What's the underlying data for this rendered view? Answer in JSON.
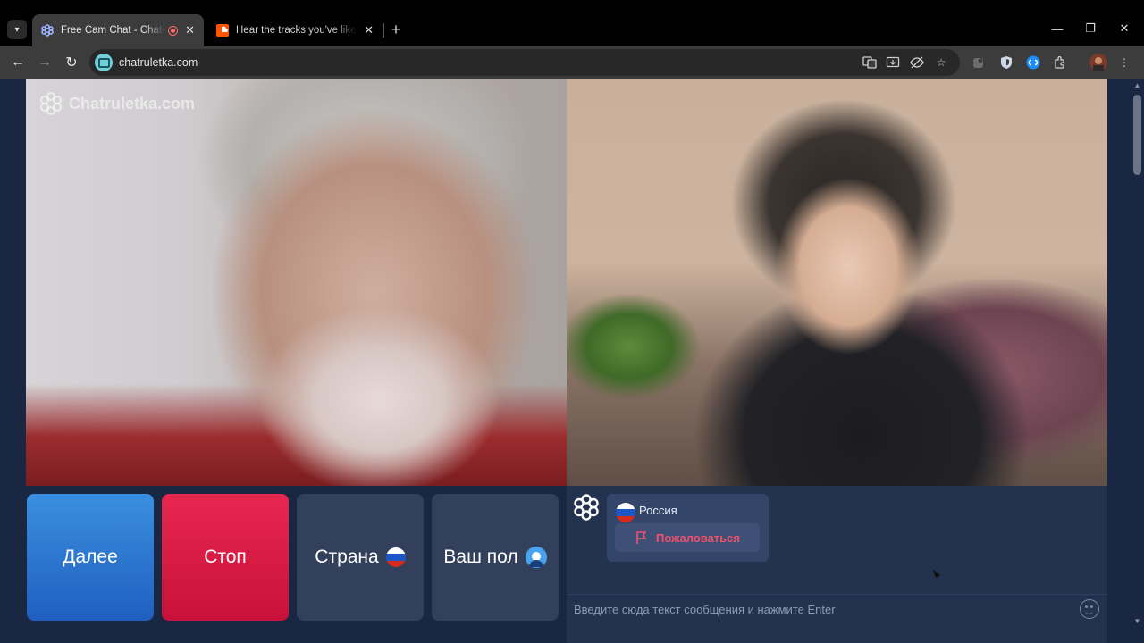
{
  "browser": {
    "tabs": [
      {
        "title": "Free Cam Chat - Chatruletka",
        "active": true
      },
      {
        "title": "Hear the tracks you've liked: on SoundCloud",
        "active": false
      }
    ],
    "url": "chatruletka.com",
    "new_tab": "+",
    "window_controls": {
      "minimize": "—",
      "restore": "❐",
      "close": "✕"
    }
  },
  "page": {
    "watermark": "Chatruletka.com",
    "buttons": {
      "next": "Далее",
      "stop": "Стоп",
      "country": "Страна",
      "gender": "Ваш пол"
    },
    "chat": {
      "partner_country": "Россия",
      "report": "Пожаловаться",
      "input_placeholder": "Введите сюда текст сообщения и нажмите Enter"
    },
    "colors": {
      "next": "#2a7ad6",
      "stop": "#e01b47",
      "report": "#f0506e",
      "page_bg": "#1a2742"
    }
  }
}
